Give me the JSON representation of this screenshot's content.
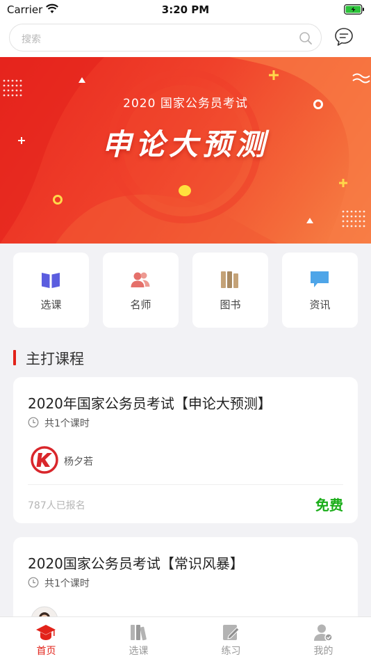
{
  "status_bar": {
    "carrier": "Carrier",
    "time": "3:20 PM"
  },
  "search": {
    "placeholder": "搜索"
  },
  "banner": {
    "subtitle": "2020 国家公务员考试",
    "title": "申论大预测"
  },
  "quick_links": [
    {
      "label": "选课",
      "icon": "book-icon",
      "color": "#5b5ddf"
    },
    {
      "label": "名师",
      "icon": "teacher-icon",
      "color": "#e5706a"
    },
    {
      "label": "图书",
      "icon": "books-icon",
      "color": "#c4a277"
    },
    {
      "label": "资讯",
      "icon": "news-icon",
      "color": "#4ea5e8"
    }
  ],
  "section": {
    "title": "主打课程"
  },
  "courses": [
    {
      "title": "2020年国家公务员考试【申论大预测】",
      "lessons": "共1个课时",
      "teacher": "杨夕若",
      "enrolled": "787人已报名",
      "price": "免费"
    },
    {
      "title": "2020国家公务员考试【常识风暴】",
      "lessons": "共1个课时"
    }
  ],
  "tabs": [
    {
      "label": "首页",
      "icon": "graduation-cap-icon",
      "active": true
    },
    {
      "label": "选课",
      "icon": "books-icon",
      "active": false
    },
    {
      "label": "练习",
      "icon": "edit-icon",
      "active": false
    },
    {
      "label": "我的",
      "icon": "user-icon",
      "active": false
    }
  ],
  "colors": {
    "accent": "#e2231a",
    "price_green": "#1aad19"
  }
}
